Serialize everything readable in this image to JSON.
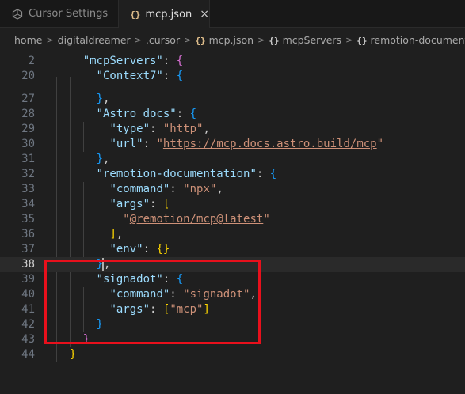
{
  "tabs": [
    {
      "label": "Cursor Settings",
      "icon": "cursor-settings-icon",
      "active": false
    },
    {
      "label": "mcp.json",
      "icon": "json-braces-icon",
      "icon_glyph": "{}",
      "close_glyph": "×",
      "active": true
    }
  ],
  "breadcrumb": [
    {
      "label": "home"
    },
    {
      "label": "digitaldreamer"
    },
    {
      "label": ".cursor"
    },
    {
      "label": "mcp.json",
      "icon_glyph": "{}"
    },
    {
      "label": "mcpServers",
      "icon_glyph": "{}"
    },
    {
      "label": "remotion-documentation",
      "icon_glyph": "{}"
    }
  ],
  "breadcrumb_separator": ">",
  "editor": {
    "current_line": "38",
    "lines": [
      {
        "num": "2",
        "parts": [
          [
            "    ",
            ""
          ],
          [
            "\"mcpServers\"",
            "key"
          ],
          [
            ": ",
            "punc"
          ],
          [
            "{",
            "b2"
          ]
        ]
      },
      {
        "num": "20",
        "parts": [
          [
            "      ",
            ""
          ],
          [
            "\"Context7\"",
            "key"
          ],
          [
            ": ",
            "punc"
          ],
          [
            "{",
            "b3"
          ]
        ]
      },
      {
        "num": "27",
        "parts": [
          [
            "      ",
            ""
          ],
          [
            "}",
            "b3"
          ],
          [
            ",",
            "punc"
          ]
        ]
      },
      {
        "num": "28",
        "parts": [
          [
            "      ",
            ""
          ],
          [
            "\"Astro docs\"",
            "key"
          ],
          [
            ": ",
            "punc"
          ],
          [
            "{",
            "b3"
          ]
        ]
      },
      {
        "num": "29",
        "parts": [
          [
            "        ",
            ""
          ],
          [
            "\"type\"",
            "key"
          ],
          [
            ": ",
            "punc"
          ],
          [
            "\"http\"",
            "str"
          ],
          [
            ",",
            "punc"
          ]
        ]
      },
      {
        "num": "30",
        "parts": [
          [
            "        ",
            ""
          ],
          [
            "\"url\"",
            "key"
          ],
          [
            ": ",
            "punc"
          ],
          [
            "\"",
            "str"
          ],
          [
            "https://mcp.docs.astro.build/mcp",
            "url"
          ],
          [
            "\"",
            "str"
          ]
        ]
      },
      {
        "num": "31",
        "parts": [
          [
            "      ",
            ""
          ],
          [
            "}",
            "b3"
          ],
          [
            ",",
            "punc"
          ]
        ]
      },
      {
        "num": "32",
        "parts": [
          [
            "      ",
            ""
          ],
          [
            "\"remotion-documentation\"",
            "key"
          ],
          [
            ": ",
            "punc"
          ],
          [
            "{",
            "b3"
          ]
        ]
      },
      {
        "num": "33",
        "parts": [
          [
            "        ",
            ""
          ],
          [
            "\"command\"",
            "key"
          ],
          [
            ": ",
            "punc"
          ],
          [
            "\"npx\"",
            "str"
          ],
          [
            ",",
            "punc"
          ]
        ]
      },
      {
        "num": "34",
        "parts": [
          [
            "        ",
            ""
          ],
          [
            "\"args\"",
            "key"
          ],
          [
            ": ",
            "punc"
          ],
          [
            "[",
            "b1"
          ]
        ]
      },
      {
        "num": "35",
        "parts": [
          [
            "          ",
            ""
          ],
          [
            "\"",
            "str"
          ],
          [
            "@remotion/mcp@latest",
            "url"
          ],
          [
            "\"",
            "str"
          ]
        ]
      },
      {
        "num": "36",
        "parts": [
          [
            "        ",
            ""
          ],
          [
            "]",
            "b1"
          ],
          [
            ",",
            "punc"
          ]
        ]
      },
      {
        "num": "37",
        "parts": [
          [
            "        ",
            ""
          ],
          [
            "\"env\"",
            "key"
          ],
          [
            ": ",
            "punc"
          ],
          [
            "{}",
            "b1"
          ]
        ]
      },
      {
        "num": "38",
        "parts": [
          [
            "      ",
            ""
          ],
          [
            "}",
            "b3"
          ],
          [
            "|cursor|",
            ""
          ],
          [
            ",",
            "punc"
          ]
        ]
      },
      {
        "num": "39",
        "parts": [
          [
            "      ",
            ""
          ],
          [
            "\"signadot\"",
            "key"
          ],
          [
            ": ",
            "punc"
          ],
          [
            "{",
            "b3"
          ]
        ]
      },
      {
        "num": "40",
        "parts": [
          [
            "        ",
            ""
          ],
          [
            "\"command\"",
            "key"
          ],
          [
            ": ",
            "punc"
          ],
          [
            "\"signadot\"",
            "str"
          ],
          [
            ",",
            "punc"
          ]
        ]
      },
      {
        "num": "41",
        "parts": [
          [
            "        ",
            ""
          ],
          [
            "\"args\"",
            "key"
          ],
          [
            ": ",
            "punc"
          ],
          [
            "[",
            "b1"
          ],
          [
            "\"mcp\"",
            "str"
          ],
          [
            "]",
            "b1"
          ]
        ]
      },
      {
        "num": "42",
        "parts": [
          [
            "      ",
            ""
          ],
          [
            "}",
            "b3"
          ]
        ]
      },
      {
        "num": "43",
        "parts": [
          [
            "    ",
            ""
          ],
          [
            "}",
            "b2"
          ]
        ]
      },
      {
        "num": "44",
        "parts": [
          [
            "  ",
            ""
          ],
          [
            "}",
            "b1"
          ]
        ]
      }
    ]
  },
  "colors": {
    "editor_bg": "#1f1f1f",
    "key": "#9cdcfe",
    "string": "#ce9178",
    "highlight_box": "#e8101c"
  }
}
